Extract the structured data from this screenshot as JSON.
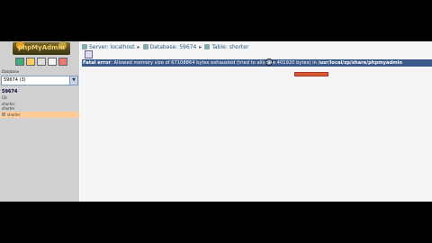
{
  "left": {
    "logo_text": "phpMyAdmin",
    "quick_icons": [
      "home-icon",
      "sql-icon",
      "query-icon",
      "docs-icon",
      "exit-icon"
    ],
    "db_label": "Database",
    "db_select": "59674 (3)",
    "db_name": "59674",
    "db_count": "(3)",
    "tables": [
      "shorter",
      "shorter"
    ],
    "selected_table": "shorter"
  },
  "breadcrumb": {
    "server_label": "Server:",
    "server": "localhost",
    "database_label": "Database:",
    "database": "59674",
    "table_label": "Table:",
    "table": "shorter",
    "separator": "▸"
  },
  "error": {
    "label": "Fatal error",
    "message": "Allowed memory size of 67108864 bytes exhausted (tried to allocate 401920 bytes) in",
    "path": "/usr/local/zp/share/phpmyadmin"
  },
  "colors": {
    "error_bar": "#3b5a8a",
    "selected_row": "#ffcc99",
    "link": "#235a81"
  }
}
